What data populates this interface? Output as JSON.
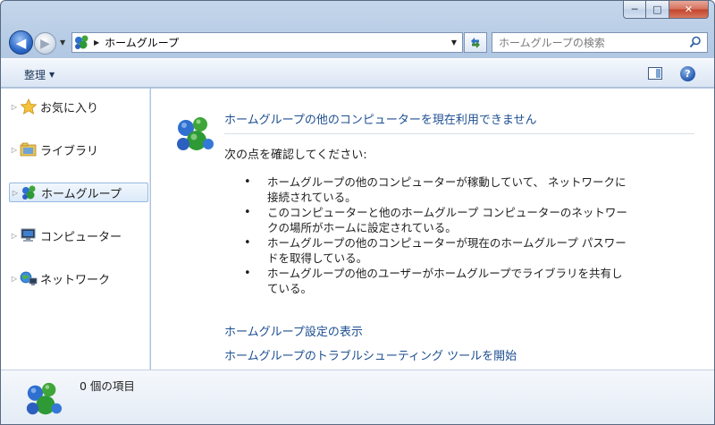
{
  "window": {
    "caption": {
      "minimize": "─",
      "maximize": "□",
      "close": "✕"
    }
  },
  "navigation": {
    "back_glyph": "◀",
    "forward_glyph": "▶",
    "address_path": "ホームグループ",
    "search_placeholder": "ホームグループの検索"
  },
  "command_bar": {
    "organize_label": "整理",
    "help_glyph": "?"
  },
  "nav_pane": {
    "items": [
      {
        "label": "お気に入り"
      },
      {
        "label": "ライブラリ"
      },
      {
        "label": "ホームグループ",
        "selected": true
      },
      {
        "label": "コンピューター"
      },
      {
        "label": "ネットワーク"
      }
    ]
  },
  "content": {
    "headline": "ホームグループの他のコンピューターを現在利用できません",
    "check_title": "次の点を確認してください:",
    "bullets": [
      "ホームグループの他のコンピューターが稼動していて、 ネットワークに接続されている。",
      "このコンピューターと他のホームグループ コンピューターのネットワークの場所がホームに設定されている。",
      "ホームグループの他のコンピューターが現在のホームグループ パスワードを取得している。",
      "ホームグループの他のユーザーがホームグループでライブラリを共有している。"
    ],
    "links": [
      "ホームグループ設定の表示",
      "ホームグループのトラブルシューティング ツールを開始"
    ]
  },
  "details": {
    "item_count": "0 個の項目"
  },
  "colors": {
    "link": "#1d4f91",
    "frame": "#b2c8e3",
    "selection_border": "#97b9e0"
  }
}
